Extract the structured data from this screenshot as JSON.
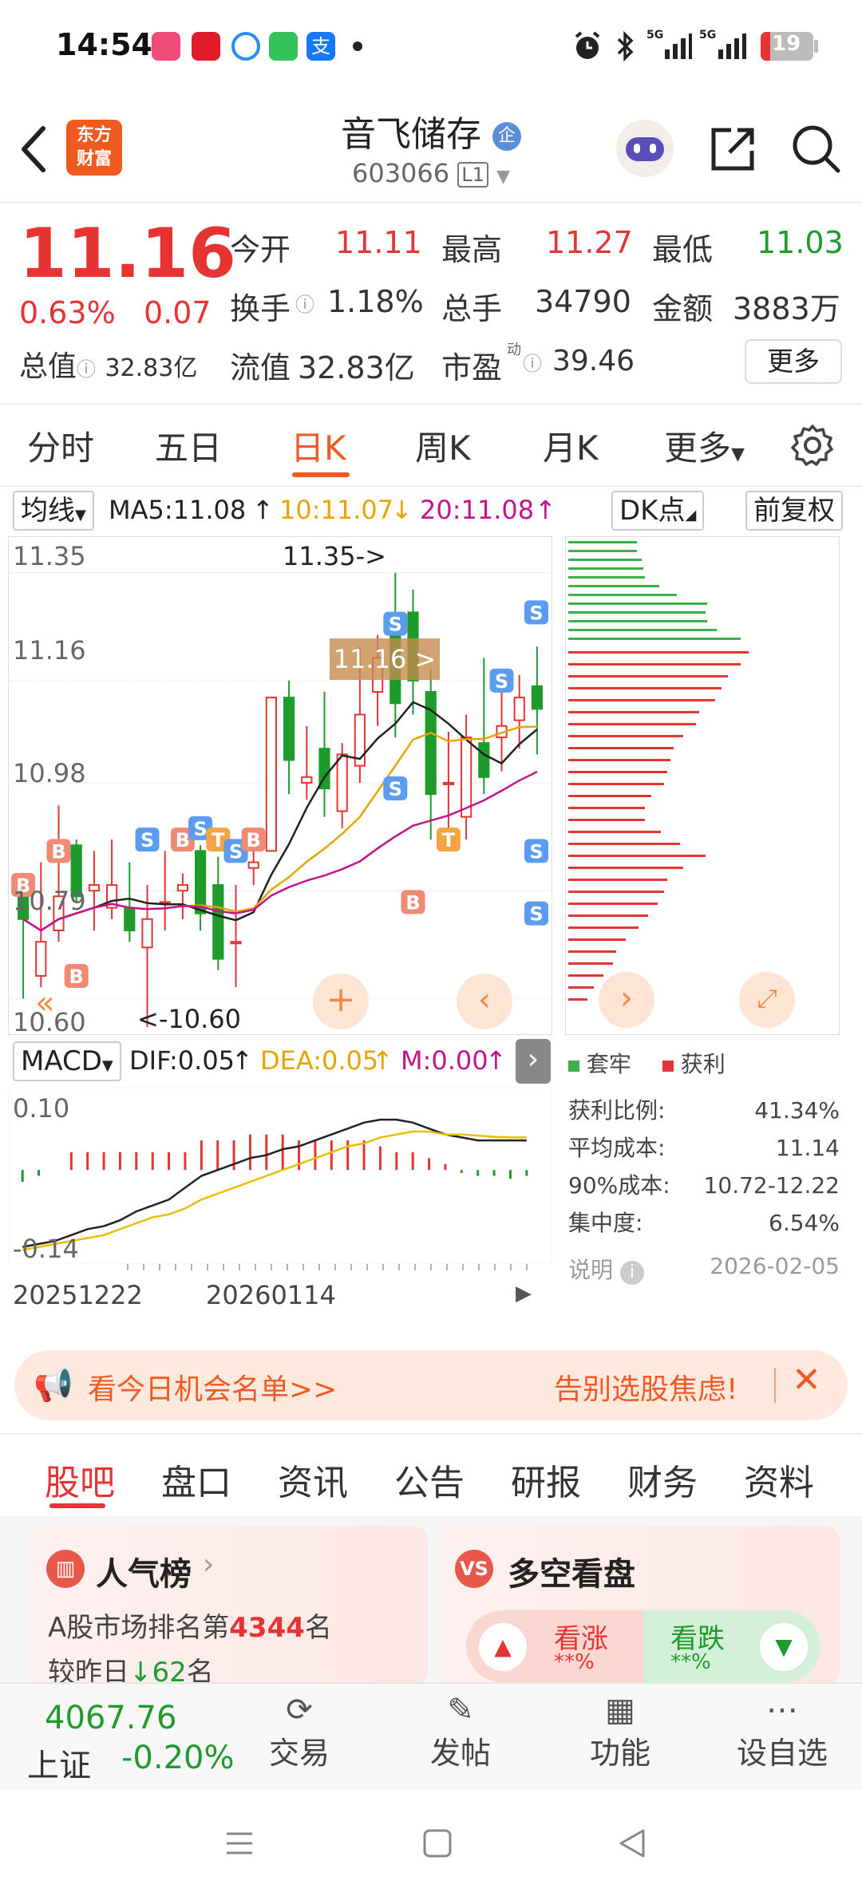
{
  "status_bar": {
    "time": "14:54",
    "battery": "19",
    "network1": "5G",
    "network2": "5G"
  },
  "header": {
    "title": "音飞储存",
    "title_badge": "企",
    "code": "603066",
    "level": "L1",
    "logo_line1": "东方",
    "logo_line2": "财富"
  },
  "quote": {
    "price": "11.16",
    "change_pct": "0.63%",
    "change_amt": "0.07",
    "fields": {
      "open_label": "今开",
      "open": "11.11",
      "high_label": "最高",
      "high": "11.27",
      "low_label": "最低",
      "low": "11.03",
      "turnover_label": "换手",
      "turnover": "1.18%",
      "volume_label": "总手",
      "volume": "34790",
      "amount_label": "金额",
      "amount": "3883万",
      "mktcap_label": "总值",
      "mktcap": "32.83亿",
      "float_label": "流值",
      "float": "32.83亿",
      "pe_label": "市盈",
      "pe_sup": "动",
      "pe": "39.46"
    },
    "more_button": "更多"
  },
  "period_tabs": [
    "分时",
    "五日",
    "日K",
    "周K",
    "月K",
    "更多"
  ],
  "active_period": "日K",
  "chart_header": {
    "indicator": "均线",
    "ma5": "MA5:11.08",
    "ma10": "10:11.07",
    "ma20": "20:11.08",
    "dk_button": "DK点",
    "adjust_button": "前复权",
    "colors": {
      "ma5": "#222222",
      "ma10": "#e8a400",
      "ma20": "#c0168c",
      "up": "#e63434",
      "down": "#1f9b2c"
    }
  },
  "chart_data": [
    {
      "type": "candlestick",
      "title": "",
      "y_ticks": [
        "11.35",
        "11.16",
        "10.98",
        "10.79",
        "10.60"
      ],
      "ylim": [
        10.55,
        11.4
      ],
      "annotations": [
        "11.35->",
        "<-10.60",
        "11.16 >"
      ],
      "candles": [
        {
          "o": 10.8,
          "c": 10.74,
          "h": 10.82,
          "l": 10.6
        },
        {
          "o": 10.64,
          "c": 10.7,
          "h": 10.84,
          "l": 10.62
        },
        {
          "o": 10.72,
          "c": 10.78,
          "h": 10.94,
          "l": 10.7
        },
        {
          "o": 10.87,
          "c": 10.78,
          "h": 10.88,
          "l": 10.77
        },
        {
          "o": 10.79,
          "c": 10.8,
          "h": 10.86,
          "l": 10.72
        },
        {
          "o": 10.76,
          "c": 10.8,
          "h": 10.88,
          "l": 10.74
        },
        {
          "o": 10.76,
          "c": 10.72,
          "h": 10.84,
          "l": 10.7
        },
        {
          "o": 10.69,
          "c": 10.74,
          "h": 10.8,
          "l": 10.55
        },
        {
          "o": 10.77,
          "c": 10.77,
          "h": 10.86,
          "l": 10.72
        },
        {
          "o": 10.79,
          "c": 10.8,
          "h": 10.82,
          "l": 10.74
        },
        {
          "o": 10.86,
          "c": 10.75,
          "h": 10.87,
          "l": 10.72
        },
        {
          "o": 10.8,
          "c": 10.67,
          "h": 10.85,
          "l": 10.65
        },
        {
          "o": 10.7,
          "c": 10.7,
          "h": 10.8,
          "l": 10.62
        },
        {
          "o": 10.83,
          "c": 10.84,
          "h": 10.88,
          "l": 10.8
        },
        {
          "o": 10.86,
          "c": 11.13,
          "h": 11.13,
          "l": 10.86
        },
        {
          "o": 11.13,
          "c": 11.02,
          "h": 11.16,
          "l": 10.96
        },
        {
          "o": 10.98,
          "c": 10.99,
          "h": 11.08,
          "l": 10.95
        },
        {
          "o": 11.04,
          "c": 10.97,
          "h": 11.14,
          "l": 10.92
        },
        {
          "o": 10.93,
          "c": 11.03,
          "h": 11.05,
          "l": 10.9
        },
        {
          "o": 11.01,
          "c": 11.1,
          "h": 11.22,
          "l": 10.98
        },
        {
          "o": 11.14,
          "c": 11.2,
          "h": 11.24,
          "l": 11.08
        },
        {
          "o": 11.26,
          "c": 11.12,
          "h": 11.35,
          "l": 11.06
        },
        {
          "o": 11.28,
          "c": 11.16,
          "h": 11.32,
          "l": 11.1
        },
        {
          "o": 11.14,
          "c": 10.96,
          "h": 11.18,
          "l": 10.88
        },
        {
          "o": 10.98,
          "c": 10.98,
          "h": 11.07,
          "l": 10.9
        },
        {
          "o": 10.92,
          "c": 11.06,
          "h": 11.1,
          "l": 10.88
        },
        {
          "o": 11.05,
          "c": 10.99,
          "h": 11.2,
          "l": 10.96
        },
        {
          "o": 11.06,
          "c": 11.08,
          "h": 11.16,
          "l": 11.0
        },
        {
          "o": 11.09,
          "c": 11.13,
          "h": 11.17,
          "l": 11.04
        },
        {
          "o": 11.15,
          "c": 11.11,
          "h": 11.22,
          "l": 11.03
        }
      ]
    },
    {
      "type": "bar",
      "title": "MACD",
      "labels": {
        "dif": "DIF:0.05",
        "dea": "DEA:0.05",
        "m": "M:0.00"
      },
      "y_ticks": [
        "0.10",
        "-0.14"
      ],
      "x_ticks": [
        "20251222",
        "20260114"
      ],
      "ylim": [
        -0.14,
        0.12
      ]
    },
    {
      "type": "bar",
      "title": "",
      "legend": [
        "套牢",
        "获利"
      ]
    }
  ],
  "chip_stats": {
    "legend_trapped": "套牢",
    "legend_profit": "获利",
    "rows": [
      {
        "label": "获利比例:",
        "value": "41.34%"
      },
      {
        "label": "平均成本:",
        "value": "11.14"
      },
      {
        "label": "90%成本:",
        "value": "10.72-12.22"
      },
      {
        "label": "集中度:",
        "value": "6.54%"
      }
    ],
    "note_label": "说明",
    "date": "2026-02-05"
  },
  "ad_bar": {
    "left_text": "看今日机会名单>>",
    "right_text": "告别选股焦虑!"
  },
  "news_tabs": [
    "股吧",
    "盘口",
    "资讯",
    "公告",
    "研报",
    "财务",
    "资料"
  ],
  "active_news_tab": "股吧",
  "popularity_card": {
    "title": "人气榜",
    "rank_prefix": "A股市场排名第",
    "rank": "4344",
    "rank_suffix": "名",
    "change_prefix": "较昨日",
    "change": "62",
    "change_suffix": "名"
  },
  "sentiment_card": {
    "title": "多空看盘",
    "bull_label": "看涨",
    "bull_pct": "**%",
    "bear_label": "看跌",
    "bear_pct": "**%"
  },
  "bottom_bar": {
    "index_value": "4067.76",
    "index_name": "上证",
    "index_change": "-0.20%",
    "items": [
      "交易",
      "发帖",
      "功能",
      "设自选"
    ]
  }
}
